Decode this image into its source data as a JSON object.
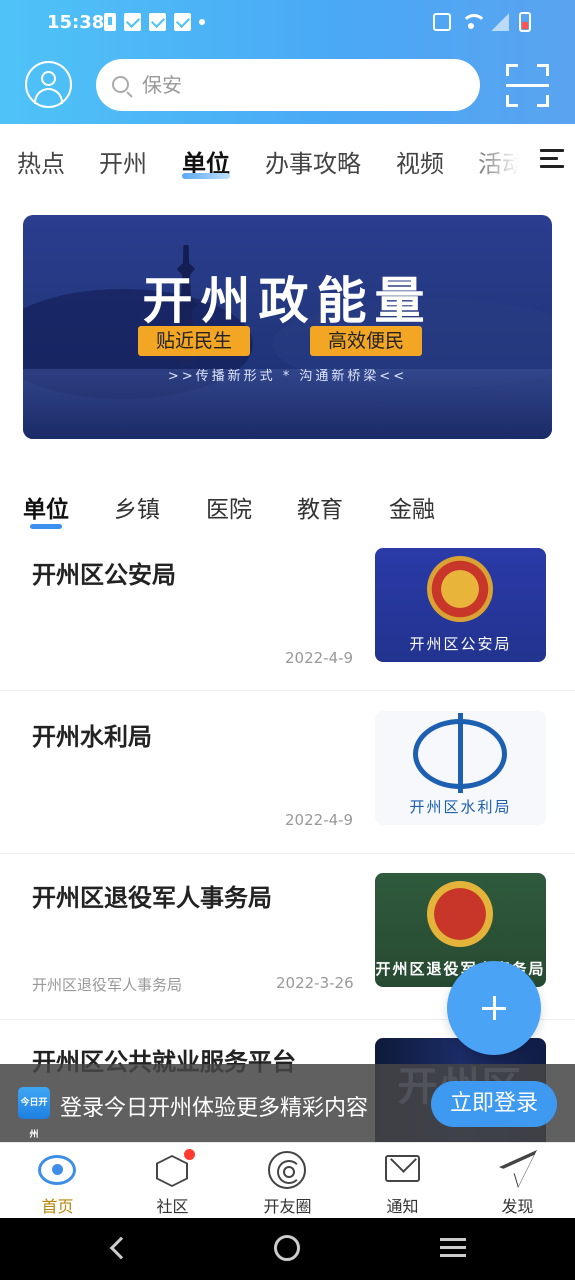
{
  "status_bar": {
    "time": "15:38"
  },
  "header": {
    "search_placeholder": "保安"
  },
  "categories": [
    {
      "label": "热点"
    },
    {
      "label": "开州"
    },
    {
      "label": "单位",
      "active": true
    },
    {
      "label": "办事攻略"
    },
    {
      "label": "视频"
    },
    {
      "label": "活动"
    }
  ],
  "banner": {
    "title": "开州政能量",
    "tag_left": "贴近民生",
    "tag_right": "高效便民",
    "slogan": ">>传播新形式 * 沟通新桥梁<<"
  },
  "subtabs": [
    {
      "label": "单位",
      "active": true
    },
    {
      "label": "乡镇"
    },
    {
      "label": "医院"
    },
    {
      "label": "教育"
    },
    {
      "label": "金融"
    }
  ],
  "list": [
    {
      "title": "开州区公安局",
      "source": "",
      "date": "2022-4-9",
      "thumb_caption": "开州区公安局"
    },
    {
      "title": "开州水利局",
      "source": "",
      "date": "2022-4-9",
      "thumb_caption": "开州区水利局"
    },
    {
      "title": "开州区退役军人事务局",
      "source": "开州区退役军人事务局",
      "date": "2022-3-26",
      "thumb_caption": "开州区退役军人事务局"
    },
    {
      "title": "开州区公共就业服务平台",
      "source": "",
      "date": "",
      "thumb_caption": "开州区"
    }
  ],
  "login_bar": {
    "logo_text": "今日开州",
    "message": "登录今日开州体验更多精彩内容",
    "button": "立即登录"
  },
  "bottom_nav": [
    {
      "label": "首页",
      "icon": "eye-icon",
      "active": true
    },
    {
      "label": "社区",
      "icon": "hexagon-icon",
      "badge": true
    },
    {
      "label": "开友圈",
      "icon": "spiral-icon"
    },
    {
      "label": "通知",
      "icon": "mail-icon"
    },
    {
      "label": "发现",
      "icon": "paper-plane-icon"
    }
  ],
  "colors": {
    "header_gradient_start": "#4fc3f7",
    "header_gradient_end": "#5aa3f0",
    "accent_blue": "#3e9af0",
    "banner_tag": "#f2a623",
    "active_nav": "#b8860b"
  }
}
